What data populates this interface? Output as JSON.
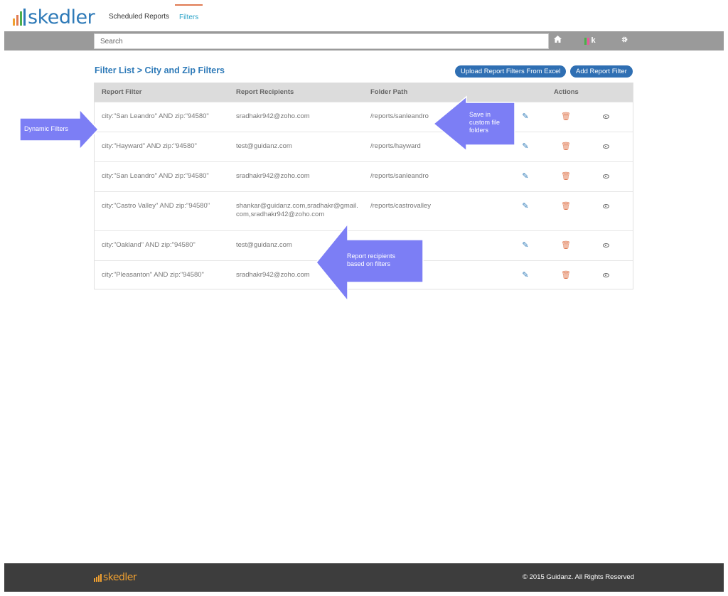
{
  "app": {
    "logo_text": "skedler",
    "logo_bar_colors": [
      "#f0a030",
      "#e07a52",
      "#4cae4c",
      "#2e7ab8"
    ]
  },
  "nav": {
    "tabs": [
      {
        "label": "Scheduled Reports",
        "active": false
      },
      {
        "label": "Filters",
        "active": true
      }
    ]
  },
  "search": {
    "placeholder": "Search",
    "value": ""
  },
  "toolbar": {
    "home_icon": "home-icon",
    "kibana_logo_text": "k",
    "settings_icon": "gear-icon"
  },
  "page": {
    "breadcrumb": "Filter List > City and Zip Filters",
    "upload_button_label": "Upload Report Filters From Excel",
    "add_button_label": "Add Report Filter"
  },
  "table": {
    "headers": {
      "filter": "Report Filter",
      "recipients": "Report Recipients",
      "folder": "Folder Path",
      "actions": "Actions"
    },
    "rows": [
      {
        "filter": "city:\"San Leandro\" AND zip:\"94580\"",
        "recipients": "sradhakr942@zoho.com",
        "folder": "/reports/sanleandro"
      },
      {
        "filter": "city:\"Hayward\" AND zip:\"94580\"",
        "recipients": "test@guidanz.com",
        "folder": "/reports/hayward"
      },
      {
        "filter": "city:\"San Leandro\" AND zip:\"94580\"",
        "recipients": "sradhakr942@zoho.com",
        "folder": "/reports/sanleandro"
      },
      {
        "filter": "city:\"Castro Valley\" AND zip:\"94580\"",
        "recipients": "shankar@guidanz.com,sradhakr@gmail.com,sradhakr942@zoho.com",
        "folder": "/reports/castrovalley"
      },
      {
        "filter": "city:\"Oakland\" AND zip:\"94580\"",
        "recipients": "test@guidanz.com",
        "folder": ""
      },
      {
        "filter": "city:\"Pleasanton\" AND zip:\"94580\"",
        "recipients": "sradhakr942@zoho.com",
        "folder": ""
      }
    ],
    "row_action_icons": [
      "pencil-icon",
      "trash-icon",
      "eye-icon"
    ]
  },
  "callouts": {
    "dynamic_filters": "Dynamic Filters",
    "save_folders": "Save in custom file folders",
    "recipients": "Report recipients based on filters"
  },
  "footer": {
    "logo_text": "skedler",
    "copyright": "© 2015 Guidanz. All Rights Reserved"
  },
  "colors": {
    "brand_blue": "#2e7ab8",
    "accent_orange": "#e07a52",
    "callout_purple": "#7c7ef5",
    "footer_bg": "#3d3d3d"
  }
}
